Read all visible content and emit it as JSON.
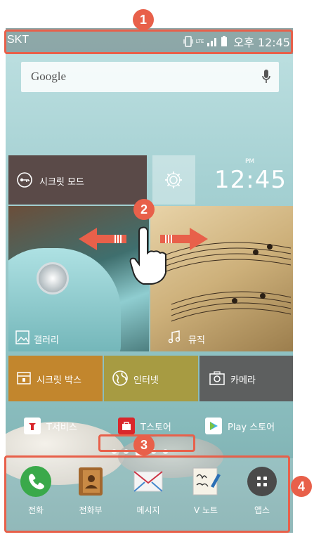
{
  "statusbar": {
    "carrier": "SKT",
    "network": "LTE",
    "time": "오후 12:45"
  },
  "search": {
    "label": "Google"
  },
  "clock": {
    "ampm": "PM",
    "time": "12:45"
  },
  "tiles": {
    "secret_mode": "시크릿 모드",
    "gallery": "갤러리",
    "music": "뮤직",
    "secret_box": "시크릿 박스",
    "internet": "인터넷",
    "camera": "카메라"
  },
  "apps": [
    {
      "label": "T서비스",
      "icon": "t-service-icon"
    },
    {
      "label": "T스토어",
      "icon": "t-store-icon"
    },
    {
      "label": "Play 스토어",
      "icon": "play-store-icon"
    }
  ],
  "dock": [
    {
      "label": "전화",
      "icon": "phone-icon"
    },
    {
      "label": "전화부",
      "icon": "contacts-icon"
    },
    {
      "label": "메시지",
      "icon": "message-icon"
    },
    {
      "label": "V 노트",
      "icon": "vnote-icon"
    },
    {
      "label": "앱스",
      "icon": "apps-grid-icon"
    }
  ],
  "page_indicator": {
    "count": 5,
    "active": 3
  },
  "callouts": {
    "one": "1",
    "two": "2",
    "three": "3",
    "four": "4"
  },
  "colors": {
    "callout": "#e8604a",
    "secret_box": "#c2862d",
    "internet": "#a79b42",
    "camera": "#5d5f5f"
  }
}
